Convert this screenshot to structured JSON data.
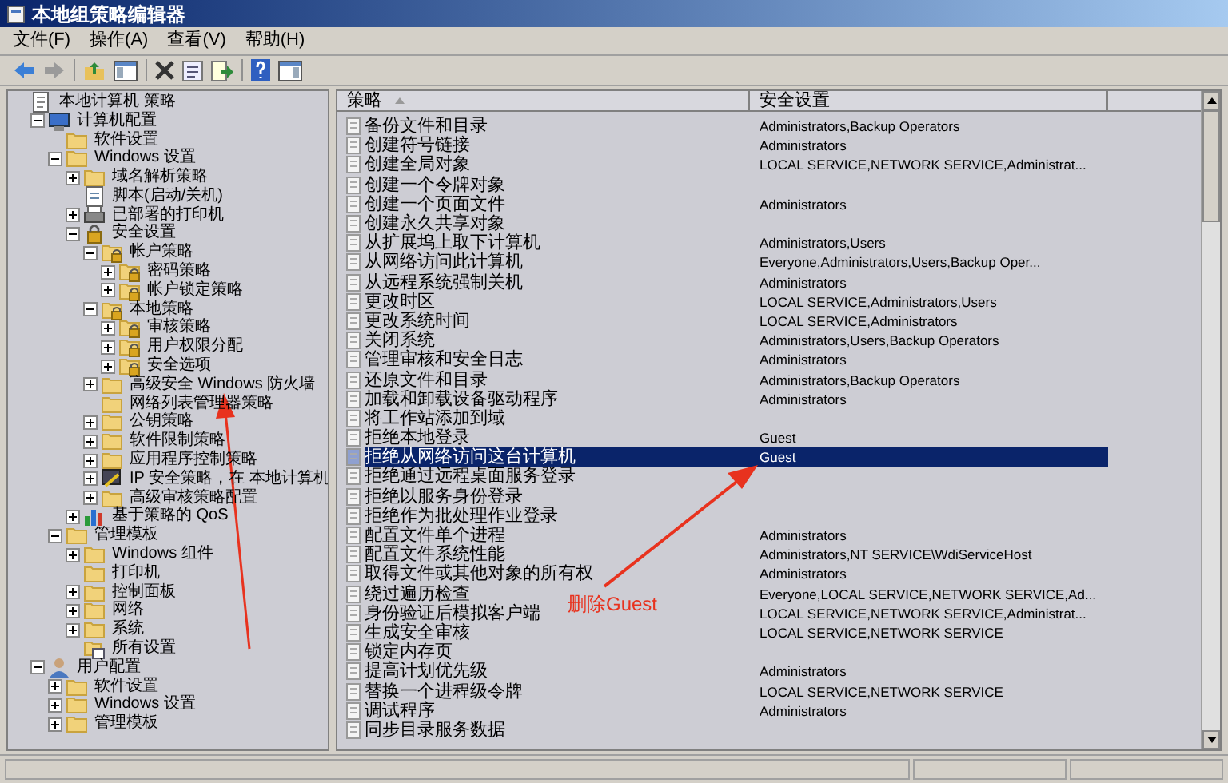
{
  "window": {
    "title": "本地组策略编辑器"
  },
  "menu": [
    "文件(F)",
    "操作(A)",
    "查看(V)",
    "帮助(H)"
  ],
  "tree": [
    {
      "label": "本地计算机 策略",
      "kind": "policy",
      "children": [
        {
          "label": "计算机配置",
          "kind": "computer",
          "expanded": true,
          "children": [
            {
              "label": "软件设置",
              "kind": "folder"
            },
            {
              "label": "Windows 设置",
              "kind": "folder",
              "expanded": true,
              "children": [
                {
                  "label": "域名解析策略",
                  "kind": "folder",
                  "expanded": false
                },
                {
                  "label": "脚本(启动/关机)",
                  "kind": "script"
                },
                {
                  "label": "已部署的打印机",
                  "kind": "printer",
                  "expanded": false
                },
                {
                  "label": "安全设置",
                  "kind": "secure",
                  "expanded": true,
                  "children": [
                    {
                      "label": "帐户策略",
                      "kind": "secure-folder",
                      "expanded": true,
                      "children": [
                        {
                          "label": "密码策略",
                          "kind": "secure-folder",
                          "expanded": false
                        },
                        {
                          "label": "帐户锁定策略",
                          "kind": "secure-folder",
                          "expanded": false
                        }
                      ]
                    },
                    {
                      "label": "本地策略",
                      "kind": "secure-folder",
                      "expanded": true,
                      "children": [
                        {
                          "label": "审核策略",
                          "kind": "secure-folder",
                          "expanded": false
                        },
                        {
                          "label": "用户权限分配",
                          "kind": "secure-folder",
                          "expanded": false
                        },
                        {
                          "label": "安全选项",
                          "kind": "secure-folder",
                          "expanded": false
                        }
                      ]
                    },
                    {
                      "label": "高级安全 Windows 防火墙",
                      "kind": "folder",
                      "expanded": false
                    },
                    {
                      "label": "网络列表管理器策略",
                      "kind": "folder"
                    },
                    {
                      "label": "公钥策略",
                      "kind": "folder",
                      "expanded": false
                    },
                    {
                      "label": "软件限制策略",
                      "kind": "folder",
                      "expanded": false
                    },
                    {
                      "label": "应用程序控制策略",
                      "kind": "folder",
                      "expanded": false
                    },
                    {
                      "label": "IP 安全策略，在 本地计算机",
                      "kind": "ip",
                      "expanded": false
                    },
                    {
                      "label": "高级审核策略配置",
                      "kind": "folder",
                      "expanded": false
                    }
                  ]
                },
                {
                  "label": "基于策略的 QoS",
                  "kind": "chart",
                  "expanded": false
                }
              ]
            },
            {
              "label": "管理模板",
              "kind": "folder",
              "expanded": true,
              "children": [
                {
                  "label": "Windows 组件",
                  "kind": "folder",
                  "expanded": false
                },
                {
                  "label": "打印机",
                  "kind": "folder"
                },
                {
                  "label": "控制面板",
                  "kind": "folder",
                  "expanded": false
                },
                {
                  "label": "网络",
                  "kind": "folder",
                  "expanded": false
                },
                {
                  "label": "系统",
                  "kind": "folder",
                  "expanded": false
                },
                {
                  "label": "所有设置",
                  "kind": "all-settings"
                }
              ]
            }
          ]
        },
        {
          "label": "用户配置",
          "kind": "user",
          "expanded": true,
          "children": [
            {
              "label": "软件设置",
              "kind": "folder",
              "expanded": false
            },
            {
              "label": "Windows 设置",
              "kind": "folder",
              "expanded": false
            },
            {
              "label": "管理模板",
              "kind": "folder",
              "expanded": false
            }
          ]
        }
      ]
    }
  ],
  "table": {
    "columns": [
      "策略",
      "安全设置"
    ],
    "rows": [
      {
        "policy": "备份文件和目录",
        "setting": "Administrators,Backup Operators",
        "selected": false
      },
      {
        "policy": "创建符号链接",
        "setting": "Administrators",
        "selected": false
      },
      {
        "policy": "创建全局对象",
        "setting": "LOCAL SERVICE,NETWORK SERVICE,Administrat...",
        "selected": false
      },
      {
        "policy": "创建一个令牌对象",
        "selected": false
      },
      {
        "policy": "创建一个页面文件",
        "setting": "Administrators",
        "selected": false
      },
      {
        "policy": "创建永久共享对象",
        "selected": false
      },
      {
        "policy": "从扩展坞上取下计算机",
        "setting": "Administrators,Users",
        "selected": false
      },
      {
        "policy": "从网络访问此计算机",
        "setting": "Everyone,Administrators,Users,Backup Oper...",
        "selected": false
      },
      {
        "policy": "从远程系统强制关机",
        "setting": "Administrators",
        "selected": false
      },
      {
        "policy": "更改时区",
        "setting": "LOCAL SERVICE,Administrators,Users",
        "selected": false
      },
      {
        "policy": "更改系统时间",
        "setting": "LOCAL SERVICE,Administrators",
        "selected": false
      },
      {
        "policy": "关闭系统",
        "setting": "Administrators,Users,Backup Operators",
        "selected": false
      },
      {
        "policy": "管理审核和安全日志",
        "setting": "Administrators",
        "selected": false
      },
      {
        "policy": "还原文件和目录",
        "setting": "Administrators,Backup Operators",
        "selected": false
      },
      {
        "policy": "加载和卸载设备驱动程序",
        "setting": "Administrators",
        "selected": false
      },
      {
        "policy": "将工作站添加到域",
        "selected": false
      },
      {
        "policy": "拒绝本地登录",
        "setting": "Guest",
        "selected": false
      },
      {
        "policy": "拒绝从网络访问这台计算机",
        "setting": "Guest",
        "selected": true
      },
      {
        "policy": "拒绝通过远程桌面服务登录",
        "selected": false
      },
      {
        "policy": "拒绝以服务身份登录",
        "selected": false
      },
      {
        "policy": "拒绝作为批处理作业登录",
        "selected": false
      },
      {
        "policy": "配置文件单个进程",
        "setting": "Administrators",
        "selected": false
      },
      {
        "policy": "配置文件系统性能",
        "setting": "Administrators,NT SERVICE\\WdiServiceHost",
        "selected": false
      },
      {
        "policy": "取得文件或其他对象的所有权",
        "setting": "Administrators",
        "selected": false
      },
      {
        "policy": "绕过遍历检查",
        "setting": "Everyone,LOCAL SERVICE,NETWORK SERVICE,Ad...",
        "selected": false
      },
      {
        "policy": "身份验证后模拟客户端",
        "setting": "LOCAL SERVICE,NETWORK SERVICE,Administrat...",
        "selected": false
      },
      {
        "policy": "生成安全审核",
        "setting": "LOCAL SERVICE,NETWORK SERVICE",
        "selected": false
      },
      {
        "policy": "锁定内存页",
        "selected": false
      },
      {
        "policy": "提高计划优先级",
        "setting": "Administrators",
        "selected": false
      },
      {
        "policy": "替换一个进程级令牌",
        "setting": "LOCAL SERVICE,NETWORK SERVICE",
        "selected": false
      },
      {
        "policy": "调试程序",
        "setting": "Administrators",
        "selected": false
      },
      {
        "policy": "同步目录服务数据",
        "selected": false
      }
    ]
  },
  "annotation": {
    "text": "删除Guest"
  }
}
